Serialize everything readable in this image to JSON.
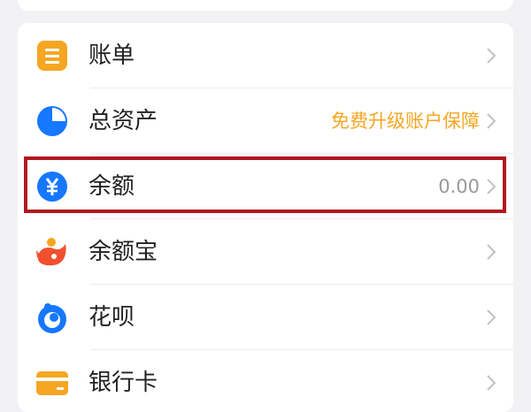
{
  "menu": {
    "items": [
      {
        "label": "账单",
        "value": "",
        "icon": "bill-icon",
        "color": "#f5a623"
      },
      {
        "label": "总资产",
        "value": "免费升级账户保障",
        "icon": "pie-chart-icon",
        "color": "#1677ff"
      },
      {
        "label": "余额",
        "value": "0.00",
        "icon": "yuan-icon",
        "color": "#1677ff"
      },
      {
        "label": "余额宝",
        "value": "",
        "icon": "yuebao-icon",
        "color": "#f0502e"
      },
      {
        "label": "花呗",
        "value": "",
        "icon": "huabei-icon",
        "color": "#1677ff"
      },
      {
        "label": "银行卡",
        "value": "",
        "icon": "bank-card-icon",
        "color": "#f5a623"
      }
    ]
  },
  "highlight": {
    "color": "#b2171d",
    "target": "余额"
  }
}
